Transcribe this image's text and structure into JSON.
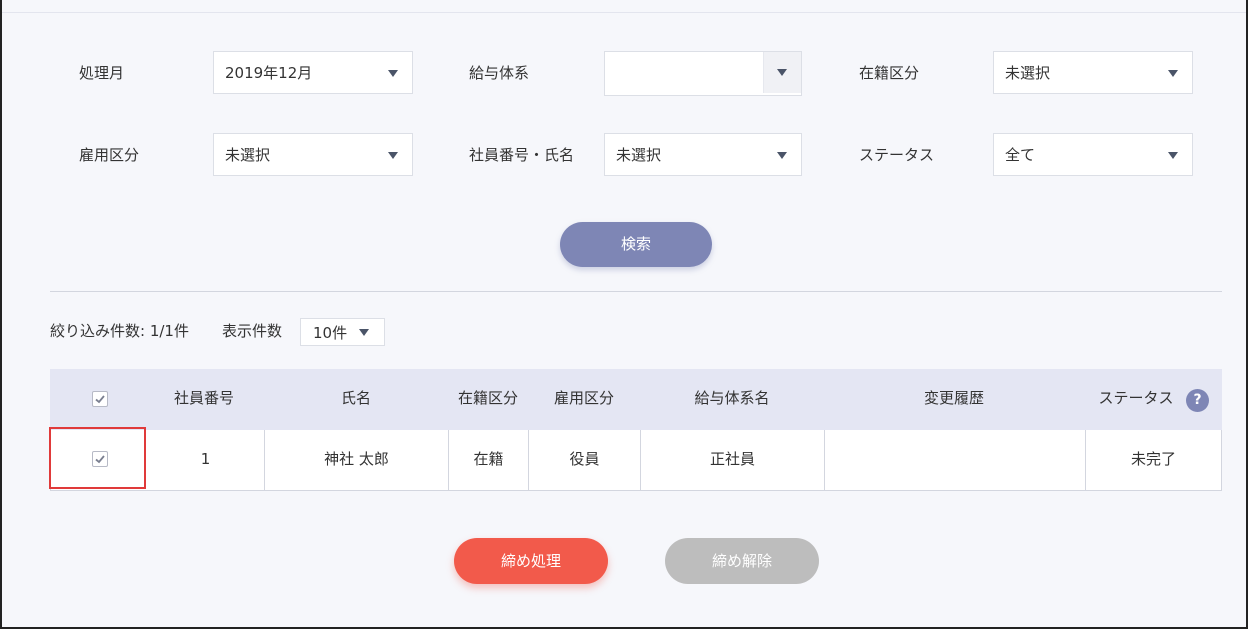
{
  "filters": {
    "processing_month": {
      "label": "処理月",
      "value": "2019年12月"
    },
    "pay_system": {
      "label": "給与体系",
      "value": ""
    },
    "enrollment_type": {
      "label": "在籍区分",
      "value": "未選択"
    },
    "employment_type": {
      "label": "雇用区分",
      "value": "未選択"
    },
    "employee": {
      "label": "社員番号・氏名",
      "value": "未選択"
    },
    "status": {
      "label": "ステータス",
      "value": "全て"
    }
  },
  "search_button": "検索",
  "results": {
    "count_text": "絞り込み件数: 1/1件",
    "per_page_label": "表示件数",
    "per_page_value": "10件"
  },
  "table": {
    "headers": {
      "employee_no": "社員番号",
      "name": "氏名",
      "enrollment": "在籍区分",
      "employment": "雇用区分",
      "pay_system": "給与体系名",
      "history": "変更履歴",
      "status": "ステータス"
    },
    "rows": [
      {
        "employee_no": "1",
        "name": "神社 太郎",
        "enrollment": "在籍",
        "employment": "役員",
        "pay_system": "正社員",
        "history": "",
        "status": "未完了"
      }
    ]
  },
  "help_icon": "?",
  "actions": {
    "close": "締め処理",
    "release": "締め解除"
  },
  "colors": {
    "primary": "#7e86b5",
    "danger": "#f25a4b",
    "disabled": "#bdbdbd",
    "highlight": "#e03a3a"
  }
}
